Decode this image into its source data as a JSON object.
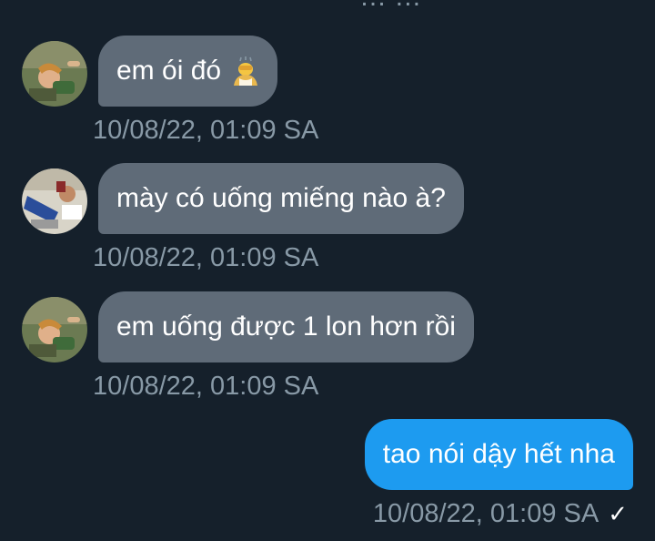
{
  "top_partial_text": "… …",
  "messages": [
    {
      "direction": "in",
      "text": "em ói đó",
      "icon": "person-bowing-emoji",
      "time": "10/08/22, 01:09 SA"
    },
    {
      "direction": "in",
      "text": "mày có uống miếng nào à?",
      "time": "10/08/22, 01:09 SA"
    },
    {
      "direction": "in",
      "text": "em uống được 1 lon hơn rồi",
      "time": "10/08/22, 01:09 SA"
    },
    {
      "direction": "out",
      "text": "tao nói dậy hết nha",
      "time": "10/08/22, 01:09 SA",
      "status_icon": "check-icon",
      "status_glyph": "✓"
    }
  ],
  "colors": {
    "background": "#15202b",
    "incoming_bubble": "#5f6b78",
    "outgoing_bubble": "#1d9bf0",
    "timestamp": "#8899a6"
  }
}
